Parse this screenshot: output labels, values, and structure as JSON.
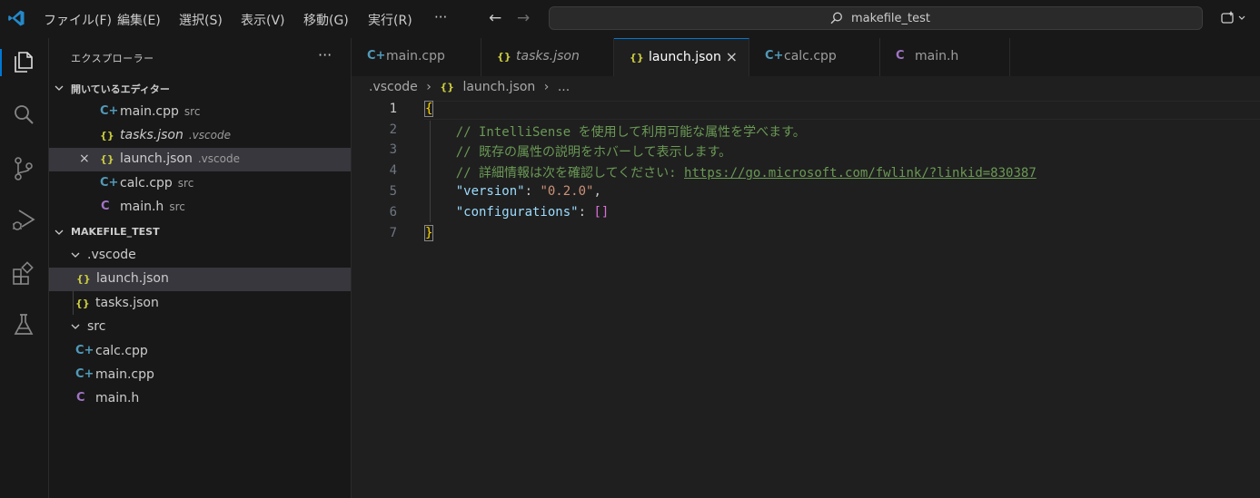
{
  "titlebar": {
    "menus": [
      "ファイル(F)",
      "編集(E)",
      "選択(S)",
      "表示(V)",
      "移動(G)",
      "実行(R)"
    ],
    "more": "···",
    "back": "←",
    "forward": "→",
    "search_text": "makefile_test"
  },
  "activity_bar": {
    "items": [
      "explorer-icon",
      "search-icon",
      "source-control-icon",
      "run-debug-icon",
      "extensions-icon",
      "testing-icon"
    ]
  },
  "sidebar": {
    "title": "エクスプローラー",
    "more": "···",
    "open_editors": {
      "label": "開いているエディター",
      "items": [
        {
          "name": "main.cpp",
          "hint": "src",
          "type": "cpp"
        },
        {
          "name": "tasks.json",
          "hint": ".vscode",
          "type": "json"
        },
        {
          "name": "launch.json",
          "hint": ".vscode",
          "type": "json"
        },
        {
          "name": "calc.cpp",
          "hint": "src",
          "type": "cpp"
        },
        {
          "name": "main.h",
          "hint": "src",
          "type": "h"
        }
      ]
    },
    "workspace": {
      "label": "MAKEFILE_TEST",
      "folder_vscode": ".vscode",
      "vscode_files": [
        "launch.json",
        "tasks.json"
      ],
      "folder_src": "src",
      "src_files": [
        "calc.cpp",
        "main.cpp",
        "main.h"
      ]
    }
  },
  "tabs": [
    {
      "label": "main.cpp",
      "type": "cpp"
    },
    {
      "label": "tasks.json",
      "type": "json"
    },
    {
      "label": "launch.json",
      "type": "json"
    },
    {
      "label": "calc.cpp",
      "type": "cpp"
    },
    {
      "label": "main.h",
      "type": "h"
    }
  ],
  "breadcrumb": {
    "folder": ".vscode",
    "file": "launch.json",
    "rest": "..."
  },
  "icons": {
    "cpp": "C+",
    "json": "{}",
    "h": "C",
    "close": "×"
  },
  "editor": {
    "line_numbers": [
      "1",
      "2",
      "3",
      "4",
      "5",
      "6",
      "7"
    ],
    "open_brace": "{",
    "comment1": "// IntelliSense を使用して利用可能な属性を学べます。",
    "comment2": "// 既存の属性の説明をホバーして表示します。",
    "comment3_prefix": "// 詳細情報は次を確認してください: ",
    "comment3_link": "https://go.microsoft.com/fwlink/?linkid=830387",
    "version_key": "\"version\"",
    "version_value": "\"0.2.0\"",
    "config_key": "\"configurations\"",
    "config_value": "[]",
    "close_brace": "}"
  },
  "colors": {
    "accent": "#0078d4",
    "cpp_icon": "#519aba",
    "json_icon": "#cbcb41",
    "h_icon": "#a074c4"
  }
}
